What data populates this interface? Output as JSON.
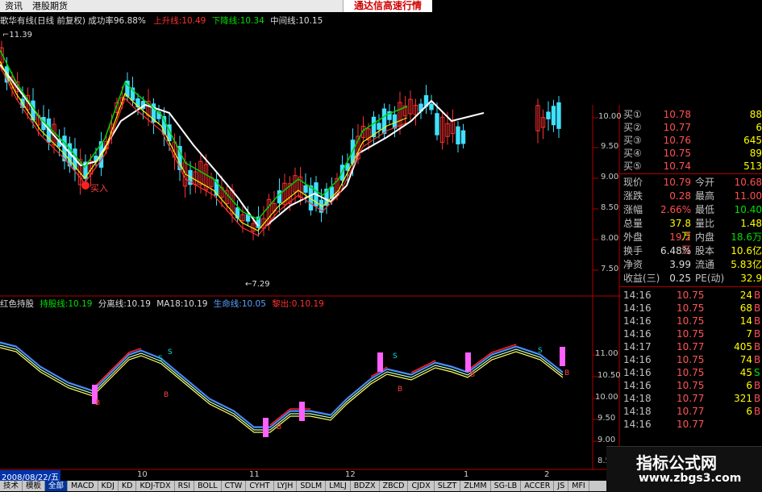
{
  "menu": {
    "items": [
      "资讯",
      "港股期货",
      "",
      "",
      "",
      "",
      ""
    ]
  },
  "promo": "通达信高速行情",
  "main_chart": {
    "title_name": "歌华有线(日线 前复权)",
    "success_rate": "成功率96.88%",
    "up_line": "上升线:10.49",
    "down_line": "下降线:10.34",
    "mid_line": "中间线:10.15",
    "high_marker": "11.39",
    "low_marker": "7.29",
    "buy_label": "买入",
    "y_ticks": [
      "10.00",
      "9.50",
      "9.00",
      "8.50",
      "8.00",
      "7.50"
    ]
  },
  "indicator": {
    "name": "红色持股",
    "hold_line": "持股线:10.19",
    "split_line": "分离线:10.19",
    "ma18": "MA18:10.19",
    "life_line": "生命线:10.05",
    "exit": "黎出:0.10.19",
    "y_ticks": [
      "11.00",
      "10.50",
      "10.00",
      "9.50",
      "9.00",
      "8.50"
    ],
    "signals": {
      "buy": "B",
      "sell": "S"
    }
  },
  "order_book": [
    {
      "label": "买①",
      "price": "10.78",
      "vol": "88"
    },
    {
      "label": "买②",
      "price": "10.77",
      "vol": "6"
    },
    {
      "label": "买③",
      "price": "10.76",
      "vol": "645"
    },
    {
      "label": "买④",
      "price": "10.75",
      "vol": "89"
    },
    {
      "label": "买⑤",
      "price": "10.74",
      "vol": "513"
    }
  ],
  "quote": [
    {
      "l1": "现价",
      "v1": "10.79",
      "l2": "今开",
      "v2": "10.68"
    },
    {
      "l1": "涨跌",
      "v1": "0.28",
      "l2": "最高",
      "v2": "11.00"
    },
    {
      "l1": "涨幅",
      "v1": "2.66%",
      "l2": "最低",
      "v2": "10.40"
    },
    {
      "l1": "总量",
      "v1": "37.8万",
      "l2": "量比",
      "v2": "1.48"
    },
    {
      "l1": "外盘",
      "v1": "19.2万",
      "l2": "内盘",
      "v2": "18.6万"
    },
    {
      "l1": "换手",
      "v1": "6.48%",
      "l2": "股本",
      "v2": "10.6亿"
    },
    {
      "l1": "净资",
      "v1": "3.99",
      "l2": "流通",
      "v2": "5.83亿"
    },
    {
      "l1": "收益(三)",
      "v1": "0.25",
      "l2": "PE(动)",
      "v2": "32.9"
    }
  ],
  "ticks": [
    {
      "time": "14:16",
      "price": "10.75",
      "vol": "24",
      "flag": "B"
    },
    {
      "time": "14:16",
      "price": "10.75",
      "vol": "68",
      "flag": "B"
    },
    {
      "time": "14:16",
      "price": "10.75",
      "vol": "14",
      "flag": "B"
    },
    {
      "time": "14:16",
      "price": "10.75",
      "vol": "7",
      "flag": "B"
    },
    {
      "time": "14:17",
      "price": "10.77",
      "vol": "405",
      "flag": "B"
    },
    {
      "time": "14:16",
      "price": "10.75",
      "vol": "74",
      "flag": "B"
    },
    {
      "time": "14:16",
      "price": "10.75",
      "vol": "45",
      "flag": "S"
    },
    {
      "time": "14:16",
      "price": "10.75",
      "vol": "6",
      "flag": "B"
    },
    {
      "time": "14:18",
      "price": "10.77",
      "vol": "321",
      "flag": "B"
    },
    {
      "time": "14:18",
      "price": "10.77",
      "vol": "6",
      "flag": "B"
    },
    {
      "time": "14:16",
      "price": "10.77",
      "vol": "",
      "flag": ""
    }
  ],
  "timebar": {
    "date": "2008/08/22/五",
    "marks": [
      "10",
      "11",
      "12",
      "1",
      "2"
    ]
  },
  "tabs": [
    "技术",
    "模板",
    "全部",
    "MACD",
    "KDJ",
    "KD",
    "KDJ-TDX",
    "RSI",
    "BOLL",
    "CTW",
    "CYHT",
    "LYJH",
    "SDLM",
    "LMLJ",
    "BDZX",
    "ZBCD",
    "CJDX",
    "SLZT",
    "ZLMM",
    "SG-LB",
    "ACCER",
    "JS",
    "MFI"
  ],
  "watermark": {
    "line1": "指标公式网",
    "line2": "www.zbgs3.com"
  }
}
